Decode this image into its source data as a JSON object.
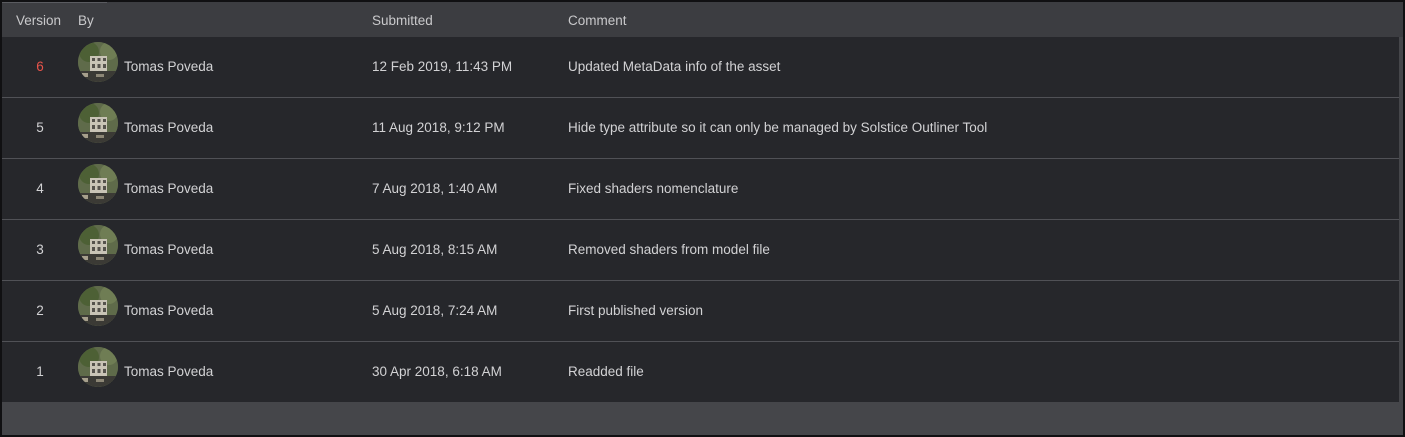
{
  "header": {
    "version": "Version",
    "by": "By",
    "submitted": "Submitted",
    "comment": "Comment"
  },
  "colors": {
    "latest_version": "#e8534a",
    "row_background": "#26272b",
    "header_background": "#3c3d41"
  },
  "avatar_icon": "user-photo-avatar",
  "rows": [
    {
      "version": "6",
      "user": "Tomas Poveda",
      "submitted": "12 Feb 2019, 11:43 PM",
      "comment": "Updated MetaData info of the asset",
      "latest": true
    },
    {
      "version": "5",
      "user": "Tomas Poveda",
      "submitted": "11 Aug 2018, 9:12 PM",
      "comment": "Hide type attribute so it can only be managed by Solstice Outliner Tool",
      "latest": false
    },
    {
      "version": "4",
      "user": "Tomas Poveda",
      "submitted": "7 Aug 2018, 1:40 AM",
      "comment": "Fixed shaders nomenclature",
      "latest": false
    },
    {
      "version": "3",
      "user": "Tomas Poveda",
      "submitted": "5 Aug 2018, 8:15 AM",
      "comment": "Removed shaders from model file",
      "latest": false
    },
    {
      "version": "2",
      "user": "Tomas Poveda",
      "submitted": "5 Aug 2018, 7:24 AM",
      "comment": "First published version",
      "latest": false
    },
    {
      "version": "1",
      "user": "Tomas Poveda",
      "submitted": "30 Apr 2018, 6:18 AM",
      "comment": "Readded file",
      "latest": false
    }
  ]
}
